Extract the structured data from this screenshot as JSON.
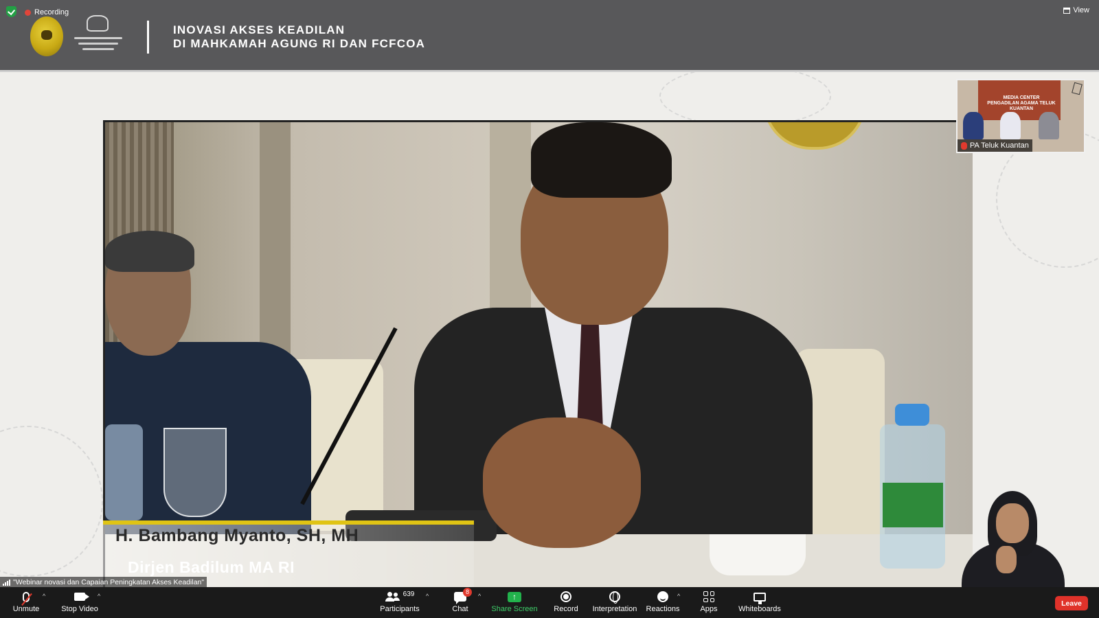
{
  "recording": {
    "label": "Recording"
  },
  "view": {
    "label": "View"
  },
  "banner": {
    "title_line1": "INOVASI AKSES KEADILAN",
    "title_line2": "DI MAHKAMAH AGUNG RI DAN FCFCOA"
  },
  "video": {
    "speaker_name": "H. Bambang Myanto, SH, MH",
    "speaker_role": "Dirjen Badilum MA RI"
  },
  "thumbnail": {
    "participant_name": "PA Teluk Kuantan",
    "backdrop_text_line1": "MEDIA CENTER",
    "backdrop_text_line2": "PENGADILAN AGAMA TELUK KUANTAN"
  },
  "status": {
    "meeting_topic": "\"Webinar  novasi dan Capaian Peningkatan Akses Keadilan\""
  },
  "toolbar": {
    "unmute": "Unmute",
    "stop_video": "Stop Video",
    "participants": "Participants",
    "participants_count": "639",
    "chat": "Chat",
    "chat_badge": "8",
    "share_screen": "Share Screen",
    "record": "Record",
    "interpretation": "Interpretation",
    "reactions": "Reactions",
    "apps": "Apps",
    "whiteboards": "Whiteboards",
    "leave": "Leave"
  },
  "colors": {
    "banner_bg": "#58585a",
    "share_green": "#22b24c",
    "leave_red": "#e0322a",
    "lower_third_yellow": "#e0c414"
  },
  "icons": [
    "shield-icon",
    "recording-dot-icon",
    "view-grid-icon",
    "mic-muted-icon",
    "video-camera-icon",
    "participants-icon",
    "chat-icon",
    "share-screen-icon",
    "record-icon",
    "globe-icon",
    "reactions-icon",
    "apps-icon",
    "whiteboard-icon",
    "signal-icon"
  ]
}
